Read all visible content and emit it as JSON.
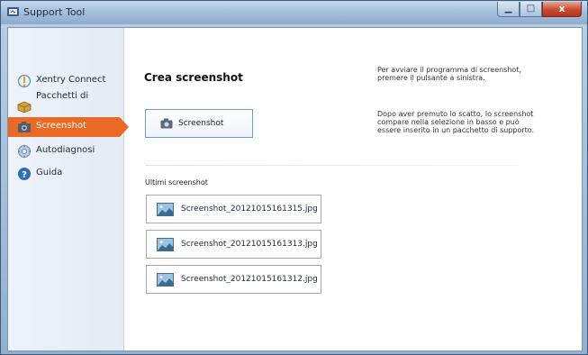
{
  "window": {
    "title": "Support Tool",
    "controls": {
      "minimize": "▁",
      "maximize": "□",
      "close": "x"
    }
  },
  "sidebar": {
    "items": [
      {
        "label": "Xentry Connect",
        "icon": "xentry-connect-icon",
        "active": false
      },
      {
        "label": "Pacchetti di",
        "icon": "package-icon",
        "active": false
      },
      {
        "label": "Screenshot",
        "icon": "camera-icon",
        "active": true
      },
      {
        "label": "Autodiagnosi",
        "icon": "autodiagnosis-icon",
        "active": false
      },
      {
        "label": "Guida",
        "icon": "help-icon",
        "active": false
      }
    ]
  },
  "main": {
    "title": "Crea screenshot",
    "screenshot_button": "Screenshot",
    "info1": "Per avviare il programma di screenshot, premere il pulsante a sinistra.",
    "info2": "Dopo aver premuto lo scatto, lo screenshot compare nella selezione in basso e può essere inserito in un pacchetto di supporto.",
    "recent_label": "Ultimi screenshot",
    "recent": [
      "Screenshot_20121015161315.jpg",
      "Screenshot_20121015161313.jpg",
      "Screenshot_20121015161312.jpg"
    ]
  },
  "colors": {
    "accent": "#ea6a25",
    "button_border": "#6f9bcb",
    "titlebar": "#a6c1de"
  }
}
